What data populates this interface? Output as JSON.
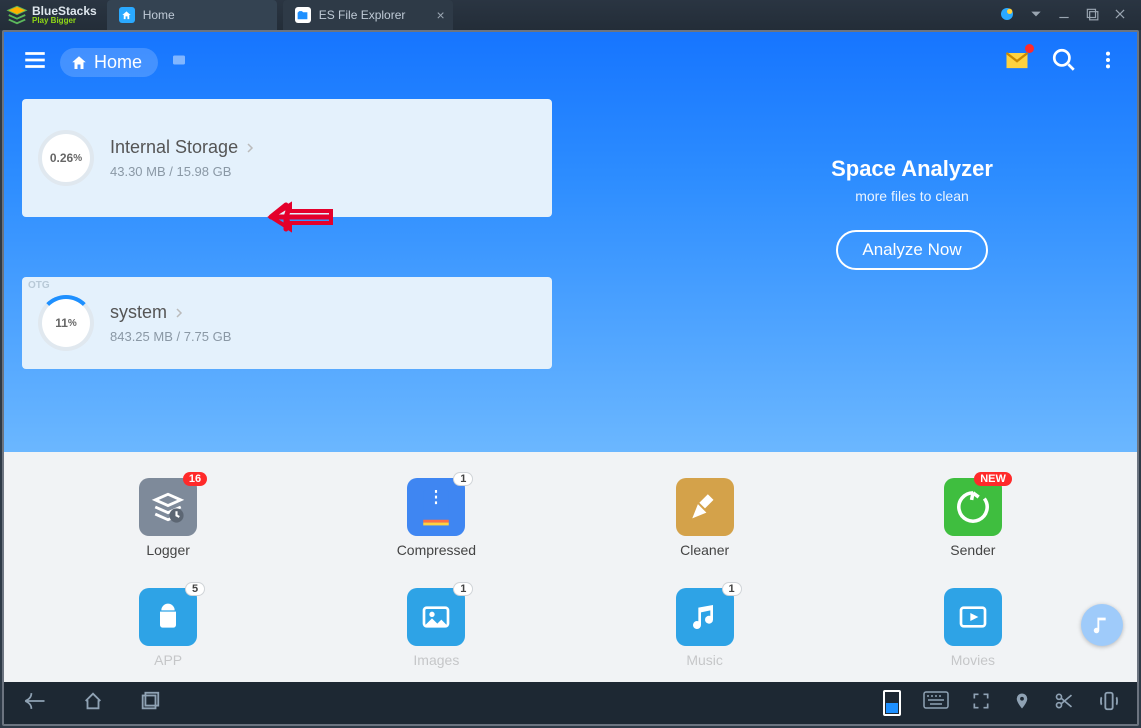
{
  "bluestacks": {
    "brand": "BlueStacks",
    "tagline": "Play Bigger",
    "tabs": [
      {
        "label": "Home",
        "icon": "home-icon"
      },
      {
        "label": "ES File Explorer",
        "icon": "es-icon",
        "active": true
      }
    ]
  },
  "app": {
    "home_pill": "Home",
    "analyzer_title": "Space Analyzer",
    "analyzer_sub": "more files to clean",
    "analyzer_btn": "Analyze Now",
    "storages": [
      {
        "label": "Internal Storage",
        "percent": "0.26",
        "unit": "%",
        "usage": "43.30 MB / 15.98 GB"
      },
      {
        "label": "system",
        "percent": "11",
        "unit": "%",
        "usage": "843.25 MB / 7.75 GB",
        "tag": "OTG"
      }
    ],
    "tiles_row1": [
      {
        "label": "Logger",
        "color": "#7e8a9a",
        "badge_red": "16"
      },
      {
        "label": "Compressed",
        "color": "#3f86f2",
        "badge_white": "1"
      },
      {
        "label": "Cleaner",
        "color": "#d4a24a"
      },
      {
        "label": "Sender",
        "color": "#3fbe3f",
        "badge_red": "NEW"
      }
    ],
    "tiles_row2": [
      {
        "label": "APP",
        "color": "#2ea3e6",
        "badge_white": "5"
      },
      {
        "label": "Images",
        "color": "#2ea3e6",
        "badge_white": "1"
      },
      {
        "label": "Music",
        "color": "#2ea3e6",
        "badge_white": "1"
      },
      {
        "label": "Movies",
        "color": "#2ea3e6"
      }
    ]
  }
}
